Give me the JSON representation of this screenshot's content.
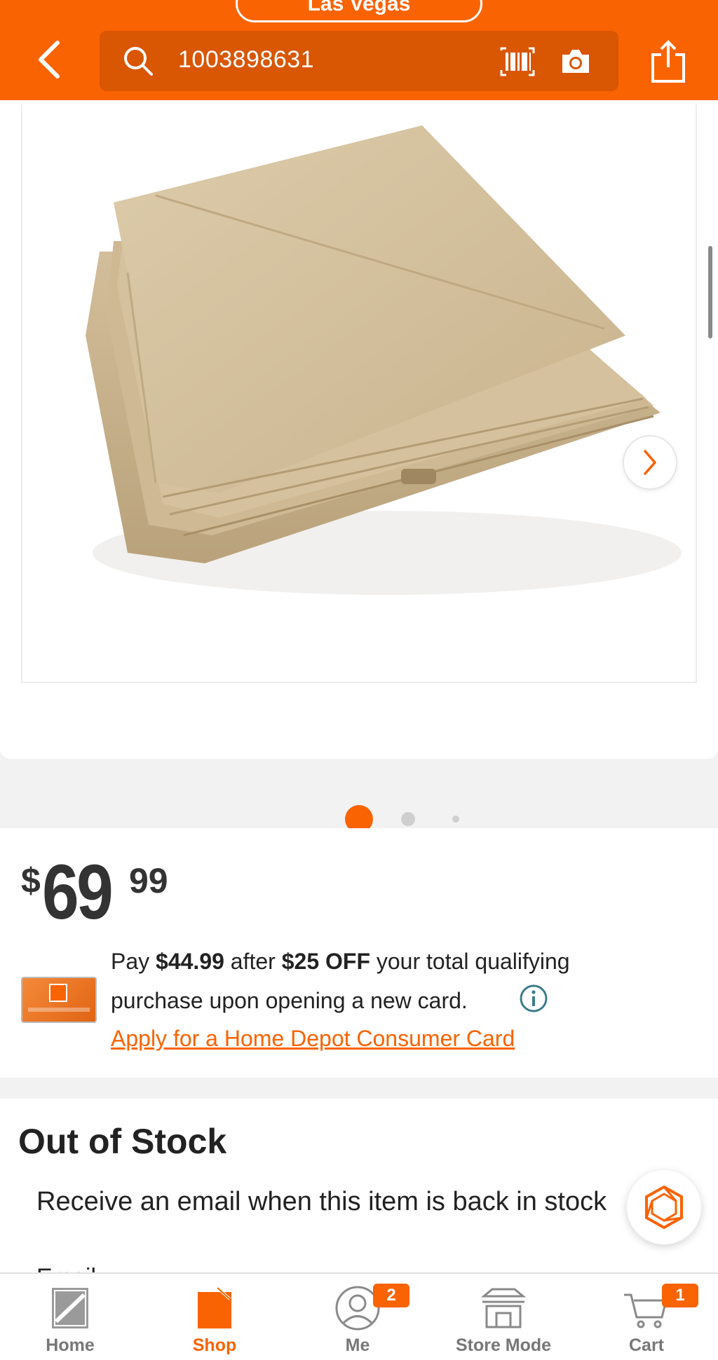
{
  "header": {
    "store_text": "Las Vegas",
    "search_value": "1003898631"
  },
  "gallery": {
    "image_alt": "Tan folded canopy fabric",
    "dots": 3,
    "active_dot": 1
  },
  "price": {
    "currency": "$",
    "dollars": "69",
    "cents": "99"
  },
  "promo": {
    "pay_prefix": "Pay ",
    "pay_amount": "$44.99",
    "after": " after ",
    "discount": "$25 OFF",
    "line1_suffix": " your total qualifying",
    "line2": "purchase upon opening a new card.",
    "apply_link": "Apply for a Home Depot Consumer Card"
  },
  "stock": {
    "title": "Out of Stock",
    "message": "Receive an email when this item is back in stock",
    "email_label": "Email"
  },
  "bottom_nav": {
    "home": "Home",
    "shop": "Shop",
    "me": "Me",
    "store_mode": "Store Mode",
    "cart": "Cart",
    "me_badge": "2",
    "cart_badge": "1"
  },
  "colors": {
    "brand_orange": "#f96302",
    "search_bg": "#d95602",
    "canopy_tan": "#d6c4a4"
  },
  "icons": {
    "back": "chevron-left-icon",
    "search": "search-icon",
    "barcode": "barcode-icon",
    "camera": "camera-icon",
    "share": "share-icon",
    "next": "chevron-right-icon",
    "info": "info-icon",
    "chat": "chat-icon",
    "home": "home-depot-logo-icon",
    "shop": "shop-icon",
    "me": "user-icon",
    "store": "store-icon",
    "cart": "cart-icon"
  }
}
